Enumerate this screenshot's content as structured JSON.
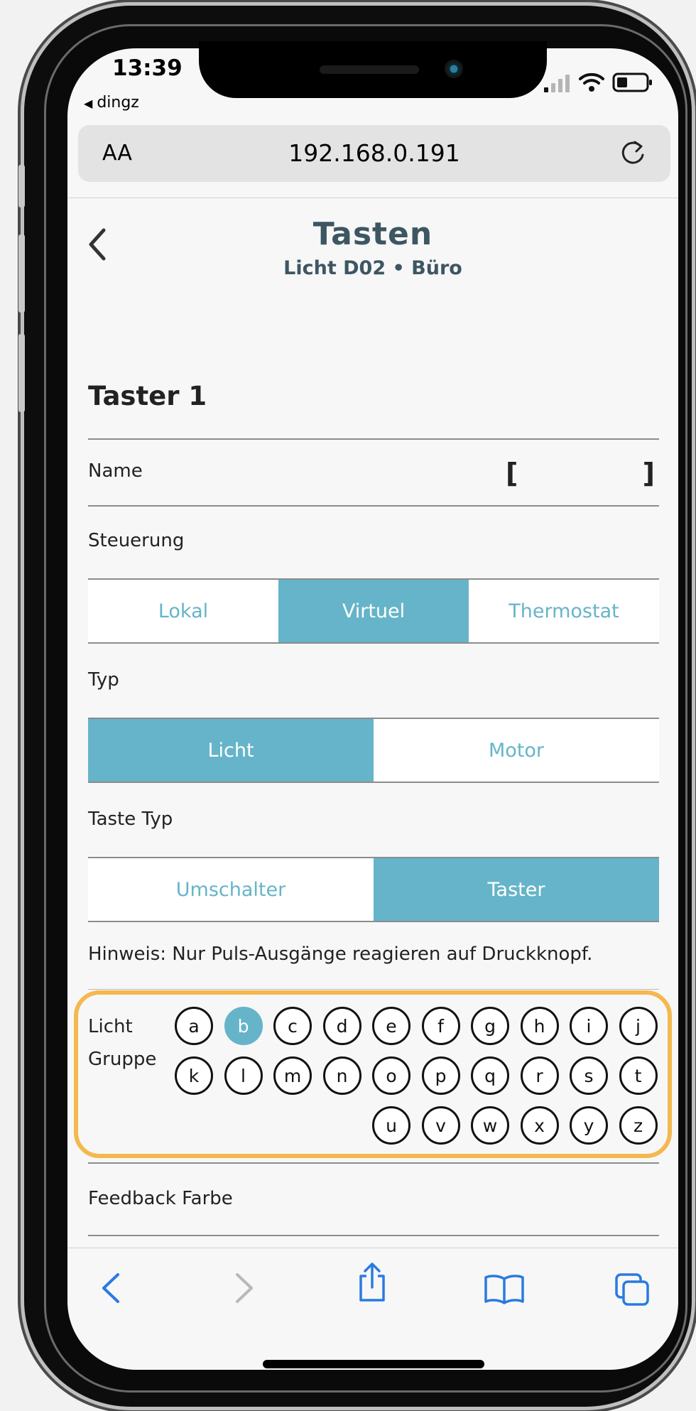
{
  "status_bar": {
    "time": "13:39",
    "back_app": "dingz"
  },
  "browser": {
    "text_size_label": "AA",
    "url": "192.168.0.191"
  },
  "header": {
    "title": "Tasten",
    "subtitle": "Licht D02 • Büro"
  },
  "section": {
    "title": "Taster 1",
    "name_label": "Name",
    "name_value_open": "[",
    "name_value_close": "]",
    "steuerung_label": "Steuerung",
    "steuerung_options": [
      "Lokal",
      "Virtuel",
      "Thermostat"
    ],
    "steuerung_selected": "Virtuel",
    "typ_label": "Typ",
    "typ_options": [
      "Licht",
      "Motor"
    ],
    "typ_selected": "Licht",
    "taste_typ_label": "Taste Typ",
    "taste_typ_options": [
      "Umschalter",
      "Taster"
    ],
    "taste_typ_selected": "Taster",
    "hint": "Hinweis: Nur Puls-Ausgänge reagieren auf Druckknopf.",
    "group_label_line1": "Licht",
    "group_label_line2": "Gruppe",
    "groups": [
      "a",
      "b",
      "c",
      "d",
      "e",
      "f",
      "g",
      "h",
      "i",
      "j",
      "k",
      "l",
      "m",
      "n",
      "o",
      "p",
      "q",
      "r",
      "s",
      "t",
      "u",
      "v",
      "w",
      "x",
      "y",
      "z"
    ],
    "group_selected": "b",
    "feedback_label": "Feedback Farbe"
  },
  "toolbar": {
    "icons": [
      "back-arrow-icon",
      "forward-arrow-icon",
      "share-icon",
      "bookmarks-icon",
      "tabs-icon"
    ]
  },
  "colors": {
    "accent": "#66b4c9",
    "highlight": "#f4b84f",
    "title": "#3d5662",
    "ios_blue": "#2a7ae2"
  }
}
